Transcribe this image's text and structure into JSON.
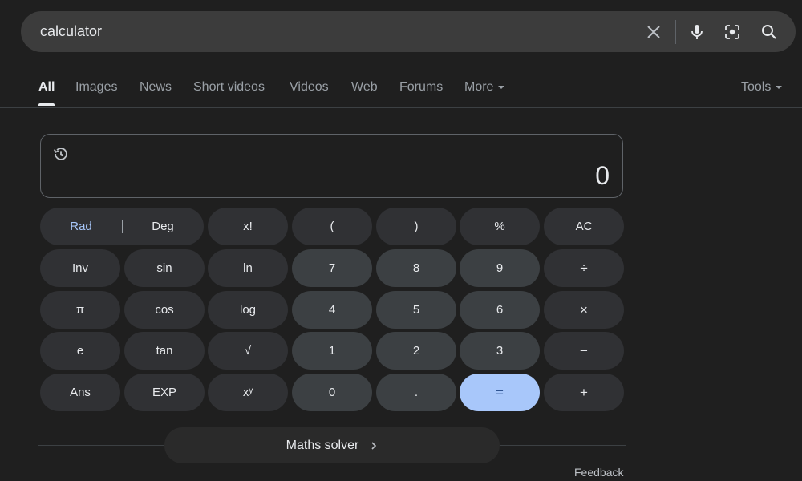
{
  "search": {
    "query": "calculator"
  },
  "tabs": [
    {
      "label": "All"
    },
    {
      "label": "Images"
    },
    {
      "label": "News"
    },
    {
      "label": "Short videos"
    },
    {
      "label": "Videos"
    },
    {
      "label": "Web"
    },
    {
      "label": "Forums"
    },
    {
      "label": "More"
    }
  ],
  "tools_label": "Tools",
  "calculator": {
    "display": "0",
    "keys": {
      "rad": "Rad",
      "deg": "Deg",
      "fact": "x!",
      "lparen": "(",
      "rparen": ")",
      "percent": "%",
      "ac": "AC",
      "inv": "Inv",
      "sin": "sin",
      "ln": "ln",
      "k7": "7",
      "k8": "8",
      "k9": "9",
      "div": "÷",
      "pi": "π",
      "cos": "cos",
      "log": "log",
      "k4": "4",
      "k5": "5",
      "k6": "6",
      "mul": "×",
      "e": "e",
      "tan": "tan",
      "sqrt": "√",
      "k1": "1",
      "k2": "2",
      "k3": "3",
      "sub": "−",
      "ans": "Ans",
      "exp": "EXP",
      "pow": "xʸ",
      "k0": "0",
      "dot": ".",
      "eq": "=",
      "add": "+"
    }
  },
  "solver_label": "Maths solver",
  "feedback_label": "Feedback",
  "colors": {
    "accent": "#a8c7fa",
    "background": "#1f1f1f",
    "key_fn": "#303134",
    "key_num": "#3c4043"
  }
}
